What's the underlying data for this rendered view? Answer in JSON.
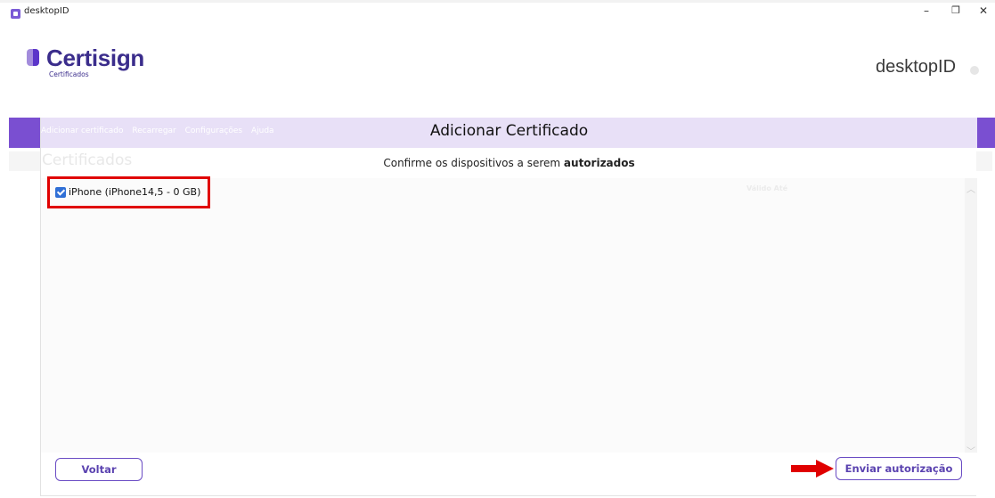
{
  "window": {
    "title": "desktopID",
    "controls": {
      "minimize": "–",
      "restore": "❐",
      "close": "✕"
    }
  },
  "header": {
    "logo_name": "Certisign",
    "logo_sub": "Certificados",
    "app_name": "desktopID"
  },
  "background": {
    "menu": [
      "Adicionar certificado",
      "Recarregar",
      "Configurações",
      "Ajuda"
    ],
    "section_title": "Certificados",
    "column_header": "Válido Até"
  },
  "modal": {
    "title": "Adicionar Certificado",
    "subtitle_prefix": "Confirme os dispositivos a serem ",
    "subtitle_bold": "autorizados",
    "devices": [
      {
        "label": "iPhone (iPhone14,5 - 0 GB)",
        "checked": true
      }
    ],
    "scroll_up": "︿",
    "scroll_down": "﹀",
    "back_button": "Voltar",
    "send_button": "Enviar autorização"
  },
  "colors": {
    "brand_purple": "#7a4fd1",
    "header_tint": "#e8e0f7",
    "button_border": "#6a4cc4",
    "highlight_red": "#e00000"
  }
}
